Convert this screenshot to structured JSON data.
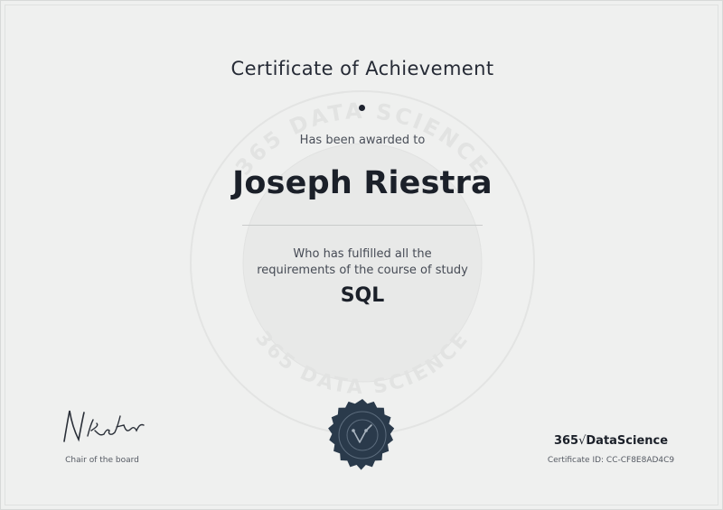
{
  "certificate": {
    "title": "Certificate of Achievement",
    "awarded_text": "Has been awarded to",
    "recipient_name": "Joseph Riestra",
    "fulfilled_line1": "Who has fulfilled all the",
    "fulfilled_line2": "requirements of the course of study",
    "course_name": "SQL"
  },
  "watermark": {
    "text": "365 DATA SCIENCE"
  },
  "signature": {
    "role": "Chair of the board"
  },
  "brand": {
    "prefix": "365",
    "radical": "√",
    "name": "DataScience"
  },
  "certificate_id": {
    "text": "Certificate ID: CC-CF8E8AD4C9"
  },
  "colors": {
    "background": "#eff0ef",
    "text_primary": "#1b2029",
    "seal": "#2a3a4b",
    "watermark": "#e6e7e6"
  }
}
